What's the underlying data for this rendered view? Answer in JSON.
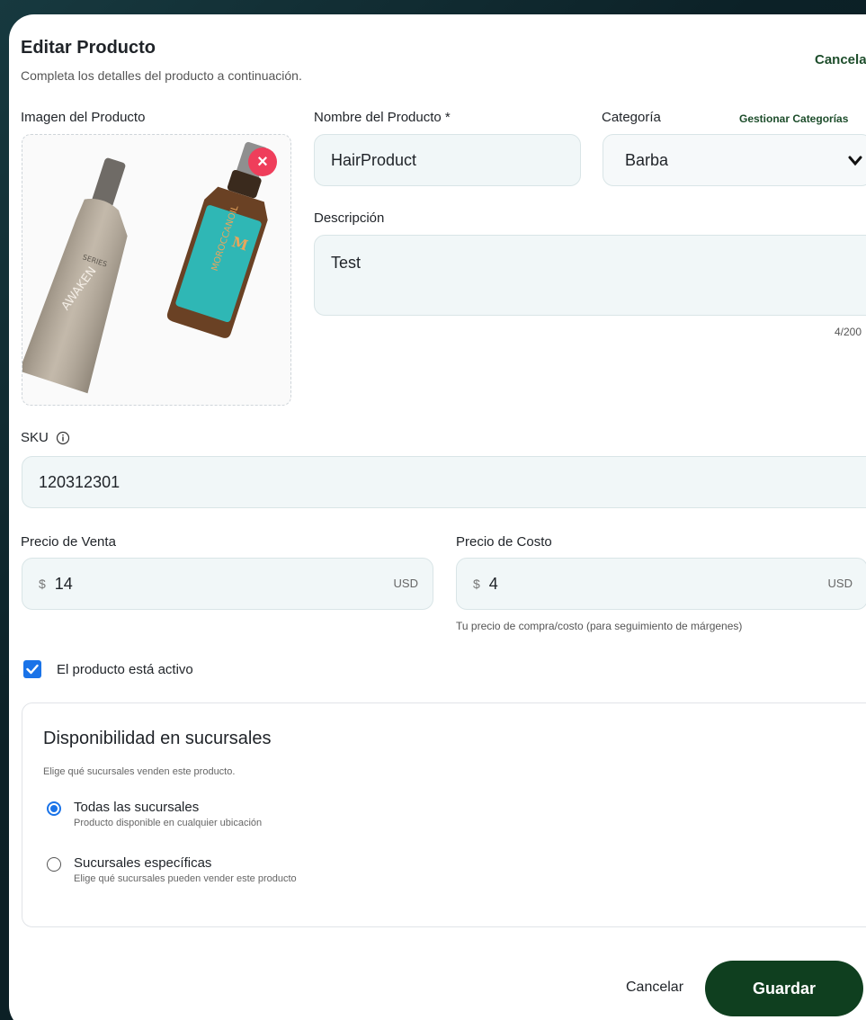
{
  "header": {
    "title": "Editar Producto",
    "subtitle": "Completa los detalles del producto a continuación.",
    "cancel_label": "Cancelar"
  },
  "image": {
    "label": "Imagen del Producto",
    "remove_icon": "close-icon"
  },
  "name": {
    "label": "Nombre del Producto *",
    "value": "HairProduct"
  },
  "category": {
    "label": "Categoría",
    "manage_label": "Gestionar Categorías",
    "selected": "Barba"
  },
  "description": {
    "label": "Descripción",
    "value": "Test",
    "counter": "4/200"
  },
  "sku": {
    "label": "SKU",
    "value": "120312301"
  },
  "sale_price": {
    "label": "Precio de Venta",
    "currency_symbol": "$",
    "value": "14",
    "currency": "USD"
  },
  "cost_price": {
    "label": "Precio de Costo",
    "currency_symbol": "$",
    "value": "4",
    "currency": "USD",
    "helper": "Tu precio de compra/costo (para seguimiento de márgenes)"
  },
  "active": {
    "label": "El producto está activo",
    "checked": true
  },
  "branches": {
    "title": "Disponibilidad en sucursales",
    "subtitle": "Elige qué sucursales venden este producto.",
    "options": [
      {
        "label": "Todas las sucursales",
        "description": "Producto disponible en cualquier ubicación",
        "selected": true
      },
      {
        "label": "Sucursales específicas",
        "description": "Elige qué sucursales pueden vender este producto",
        "selected": false
      }
    ]
  },
  "footer": {
    "cancel_label": "Cancelar",
    "save_label": "Guardar"
  },
  "colors": {
    "accent": "#1a73e8",
    "brand_green": "#0f3f1f",
    "danger": "#ef3e5b"
  }
}
